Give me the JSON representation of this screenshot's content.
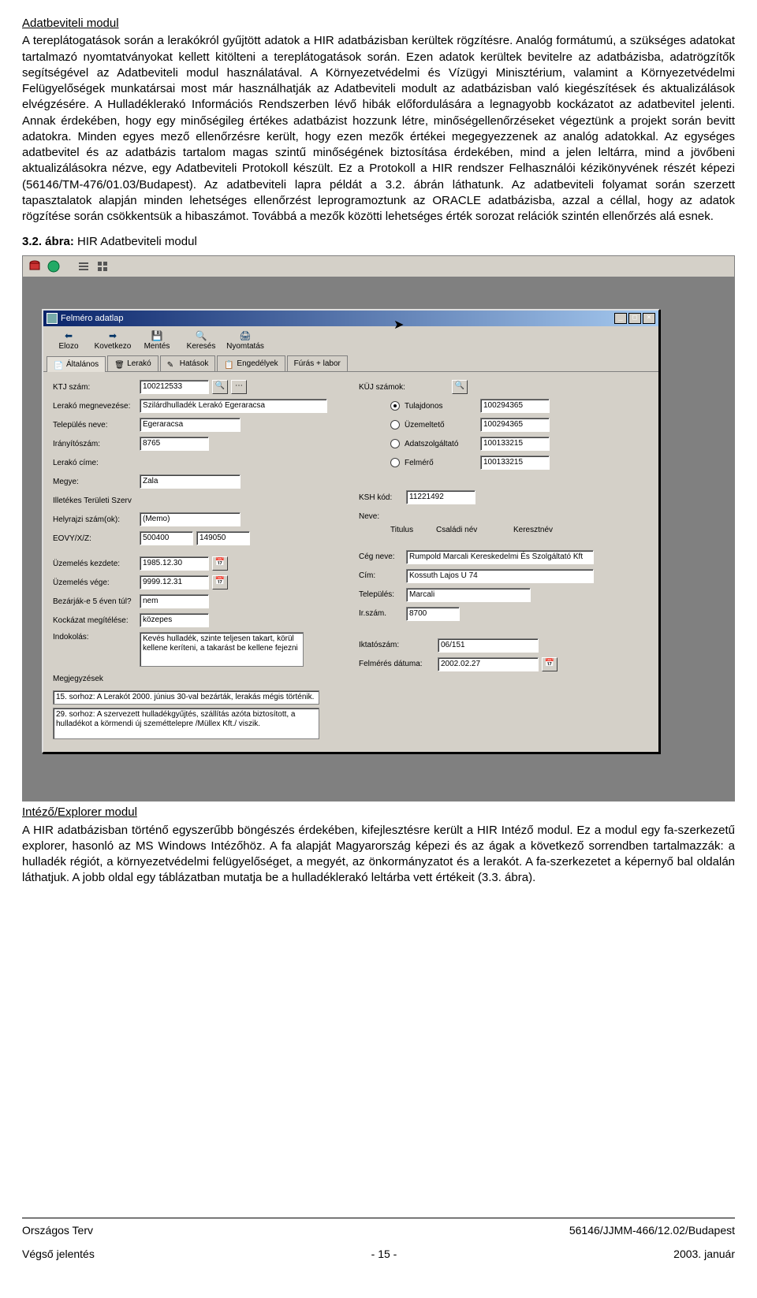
{
  "section1_title": "Adatbeviteli modul",
  "para1": "A tereplátogatások során a lerakókról gyűjtött adatok a HIR adatbázisban kerültek rögzítésre. Analóg formátumú, a szükséges adatokat tartalmazó nyomtatványokat kellett kitölteni a tereplátogatások során. Ezen adatok kerültek bevitelre az adatbázisba, adatrögzítők segítségével az Adatbeviteli modul használatával. A Környezetvédelmi és Vízügyi Minisztérium, valamint a Környezetvédelmi Felügyelőségek munkatársai most már használhatják az Adatbeviteli modult az adatbázisban való kiegészítések és aktualizálások elvégzésére. A Hulladéklerakó Információs Rendszerben lévő hibák előfordulására a legnagyobb kockázatot az adatbevitel jelenti. Annak érdekében, hogy egy minőségileg értékes adatbázist hozzunk létre, minőségellenőrzéseket végeztünk a projekt során bevitt adatokra. Minden egyes mező ellenőrzésre került, hogy ezen mezők értékei megegyezzenek az analóg adatokkal. Az egységes adatbevitel és az adatbázis tartalom magas szintű minőségének biztosítása érdekében, mind a jelen leltárra, mind a jövőbeni aktualizálásokra nézve, egy Adatbeviteli Protokoll készült. Ez a Protokoll a HIR rendszer Felhasználói kézikönyvének részét képezi (56146/TM-476/01.03/Budapest). Az adatbeviteli lapra példát a 3.2. ábrán láthatunk. Az adatbeviteli folyamat során szerzett tapasztalatok alapján minden lehetséges ellenőrzést leprogramoztunk az ORACLE adatbázisba, azzal a céllal, hogy az adatok rögzítése során csökkentsük a hibaszámot. Továbbá a mezők közötti lehetséges érték sorozat relációk szintén ellenőrzés alá esnek.",
  "figure_caption_prefix": "3.2. ábra:",
  "figure_caption_text": " HIR Adatbeviteli modul",
  "app": {
    "inner_title": "Felméro adatlap",
    "toolbar": {
      "prev": "Elozo",
      "next": "Kovetkezo",
      "save": "Mentés",
      "search": "Keresés",
      "print": "Nyomtatás"
    },
    "tabs": [
      "Általános",
      "Lerakó",
      "Hatások",
      "Engedélyek",
      "Fúrás + labor"
    ],
    "left": {
      "ktj_label": "KTJ szám:",
      "ktj": "100212533",
      "megnev_label": "Lerakó megnevezése:",
      "megnev": "Szilárdhulladék Lerakó Egeraracsa",
      "telep_label": "Település neve:",
      "telep": "Egeraracsa",
      "iranyito_label": "Irányítószám:",
      "iranyito": "8765",
      "cim_label": "Lerakó címe:",
      "megye_label": "Megye:",
      "megye": "Zala",
      "illetekes_label": "Illetékes Területi Szerv",
      "helyrajzi_label": "Helyrajzi szám(ok):",
      "helyrajzi": "(Memo)",
      "eov_label": "EOVY/X/Z:",
      "eov_y": "500400",
      "eov_x": "149050",
      "uzem_k_label": "Üzemelés kezdete:",
      "uzem_k": "1985.12.30",
      "uzem_v_label": "Üzemelés vége:",
      "uzem_v": "9999.12.31",
      "bezar_label": "Bezárják-e 5 éven túl?",
      "bezar": "nem",
      "kock_label": "Kockázat megítélése:",
      "kock": "közepes",
      "indok_label": "Indokolás:",
      "indok": "Kevés hulladék, szinte teljesen takart, körül kellene keríteni, a takarást be kellene fejezni",
      "megj_label": "Megjegyzések",
      "sor15": "15. sorhoz: A Lerakót 2000. június 30-val bezárták, lerakás mégis történik.",
      "sor29": "29. sorhoz: A szervezett hulladékgyűjtés, szállítás azóta biztosított, a hulladékot a körmendi új szeméttelepre /Müllex Kft./ viszik."
    },
    "right": {
      "kuj_label": "KÜJ számok:",
      "r1": "Tulajdonos",
      "r1v": "100294365",
      "r2": "Üzemeltető",
      "r2v": "100294365",
      "r3": "Adatszolgáltató",
      "r3v": "100133215",
      "r4": "Felmérő",
      "r4v": "100133215",
      "ksh_label": "KSH kód:",
      "ksh": "11221492",
      "neve_label": "Neve:",
      "name_cols": [
        "Titulus",
        "Családi név",
        "Keresztnév"
      ],
      "ceg_label": "Cég neve:",
      "ceg": "Rumpold Marcali Kereskedelmi És Szolgáltató Kft",
      "cim_label": "Cím:",
      "cim": "Kossuth Lajos U 74",
      "telep_label": "Település:",
      "telep": "Marcali",
      "irszam_label": "Ir.szám.",
      "irszam": "8700",
      "iktato_label": "Iktatószám:",
      "iktato": "06/151",
      "felm_label": "Felmérés dátuma:",
      "felm": "2002.02.27"
    }
  },
  "section2_title": "Intéző/Explorer modul",
  "para2": "A HIR adatbázisban történő egyszerűbb böngészés érdekében, kifejlesztésre került a HIR Intéző modul. Ez a modul egy fa-szerkezetű explorer, hasonló az MS Windows Intézőhöz. A fa alapját Magyarország képezi és az ágak a következő sorrendben tartalmazzák: a hulladék régiót, a környezetvédelmi felügyelőséget, a megyét, az önkormányzatot és a lerakót. A fa-szerkezetet a képernyő bal oldalán láthatjuk. A jobb oldal egy táblázatban mutatja be a hulladéklerakó leltárba vett értékeit (3.3. ábra).",
  "footer": {
    "left1": "Országos Terv",
    "right1": "56146/JJMM-466/12.02/Budapest",
    "left2": "Végső jelentés",
    "center2": "- 15 -",
    "right2": "2003. január"
  }
}
